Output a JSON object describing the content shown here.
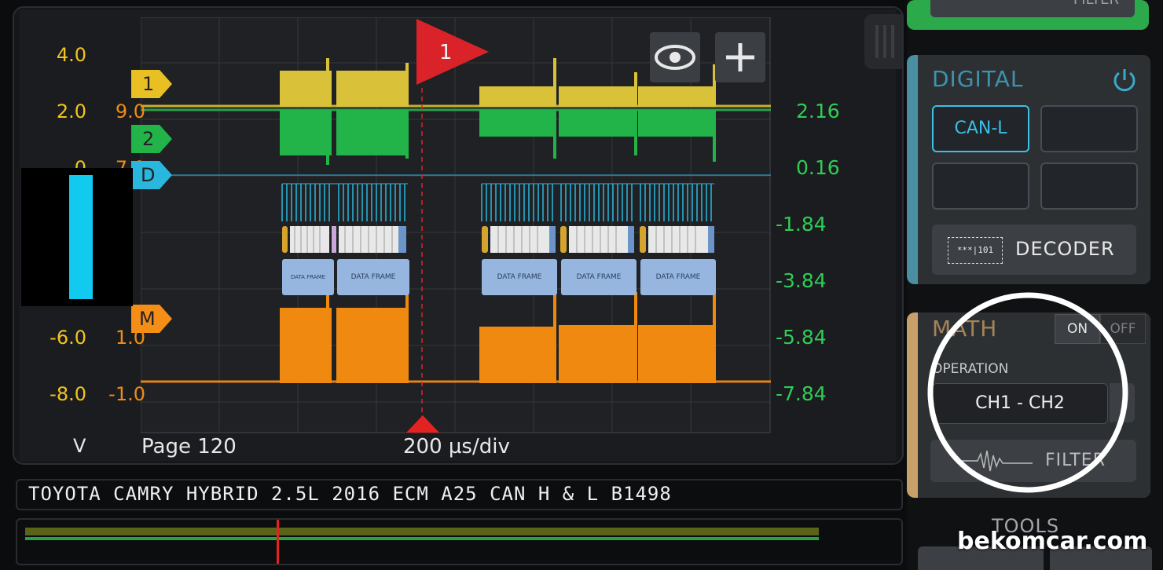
{
  "scope": {
    "left_axis_ch1": [
      "4.0",
      "2.0",
      "0",
      "-6.0",
      "-8.0"
    ],
    "left_axis_ch2": [
      "9.0",
      "7.0",
      "1.0",
      "-1.0"
    ],
    "right_axis": [
      "2.16",
      "0.16",
      "-1.84",
      "-3.84",
      "-5.84",
      "-7.84"
    ],
    "unit_label": "V",
    "page_label": "Page 120",
    "timebase": "200 µs/div",
    "trigger_label": "1",
    "markers": {
      "ch1": "1",
      "ch2": "2",
      "digital": "D",
      "math": "M"
    },
    "frame_labels": [
      "DATA FRAME",
      "DATA FRAME",
      "DATA FRAME",
      "DATA FRAME",
      "DATA FRAME"
    ]
  },
  "title_bar": "TOYOTA CAMRY HYBRID 2.5L 2016 ECM A25 CAN H & L B1498",
  "panels": {
    "top_filter_label": "FILTER",
    "digital": {
      "title": "DIGITAL",
      "channel_button": "CAN-L",
      "decoder_icon_text": "***|101",
      "decoder_label": "DECODER"
    },
    "math": {
      "title": "MATH",
      "on_label": "ON",
      "off_label": "OFF",
      "operation_label": "OPERATION",
      "operation_value": "CH1 - CH2",
      "filter_label": "FILTER"
    },
    "tools_label": "TOOLS"
  },
  "watermark": "bekomcar.com",
  "colors": {
    "ch1": "#f2c41d",
    "ch2": "#2fcc56",
    "digital": "#2ab7dd",
    "math": "#f58e16",
    "trigger": "#e32222"
  }
}
